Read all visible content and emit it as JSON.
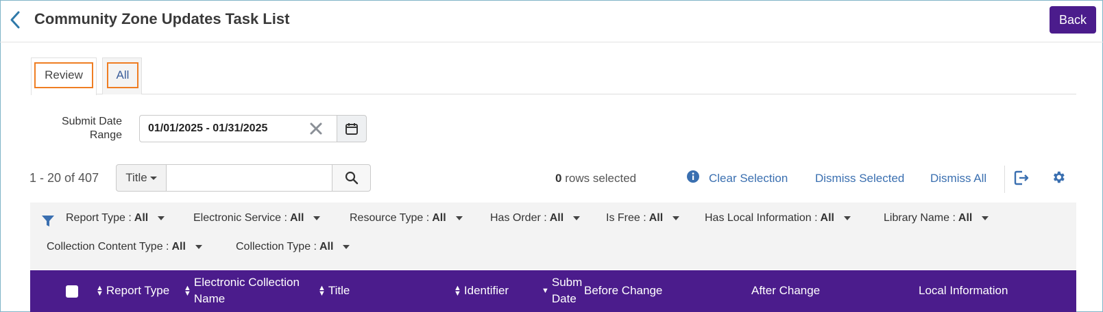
{
  "header": {
    "title": "Community Zone Updates Task List",
    "back_label": "Back"
  },
  "tabs": [
    {
      "label": "Review",
      "active": true
    },
    {
      "label": "All",
      "active": false
    }
  ],
  "date_filter": {
    "label": "Submit Date Range",
    "value": "01/01/2025 - 01/31/2025"
  },
  "toolbar": {
    "result_count": "1 - 20 of 407",
    "search_field": "Title",
    "search_value": "",
    "rows_selected_count": "0",
    "rows_selected_text": "rows selected",
    "clear_selection": "Clear Selection",
    "dismiss_selected": "Dismiss Selected",
    "dismiss_all": "Dismiss All"
  },
  "facets": [
    {
      "label": "Report Type :",
      "value": "All"
    },
    {
      "label": "Electronic Service :",
      "value": "All"
    },
    {
      "label": "Resource Type :",
      "value": "All"
    },
    {
      "label": "Has Order :",
      "value": "All"
    },
    {
      "label": "Is Free :",
      "value": "All"
    },
    {
      "label": "Has Local Information :",
      "value": "All"
    },
    {
      "label": "Library Name :",
      "value": "All"
    },
    {
      "label": "Collection Content Type :",
      "value": "All"
    },
    {
      "label": "Collection Type :",
      "value": "All"
    }
  ],
  "table": {
    "columns": [
      {
        "label": "Report Type",
        "sortable": true
      },
      {
        "label": "Electronic Collection Name",
        "sortable": true
      },
      {
        "label": "Title",
        "sortable": true
      },
      {
        "label": "Identifier",
        "sortable": true
      },
      {
        "label": "Submit Date",
        "sortable": true
      },
      {
        "label": "Before Change",
        "sortable": false
      },
      {
        "label": "After Change",
        "sortable": false
      },
      {
        "label": "Local Information",
        "sortable": false
      }
    ]
  },
  "colors": {
    "brand_purple": "#4b1c8c",
    "link_blue": "#3a6fb0",
    "tab_highlight": "#ef7d22"
  },
  "icons": [
    "chevron-left-icon",
    "close-icon",
    "calendar-icon",
    "caret-down-icon",
    "search-icon",
    "info-icon",
    "export-icon",
    "gear-icon",
    "filter-icon",
    "sort-icon"
  ]
}
